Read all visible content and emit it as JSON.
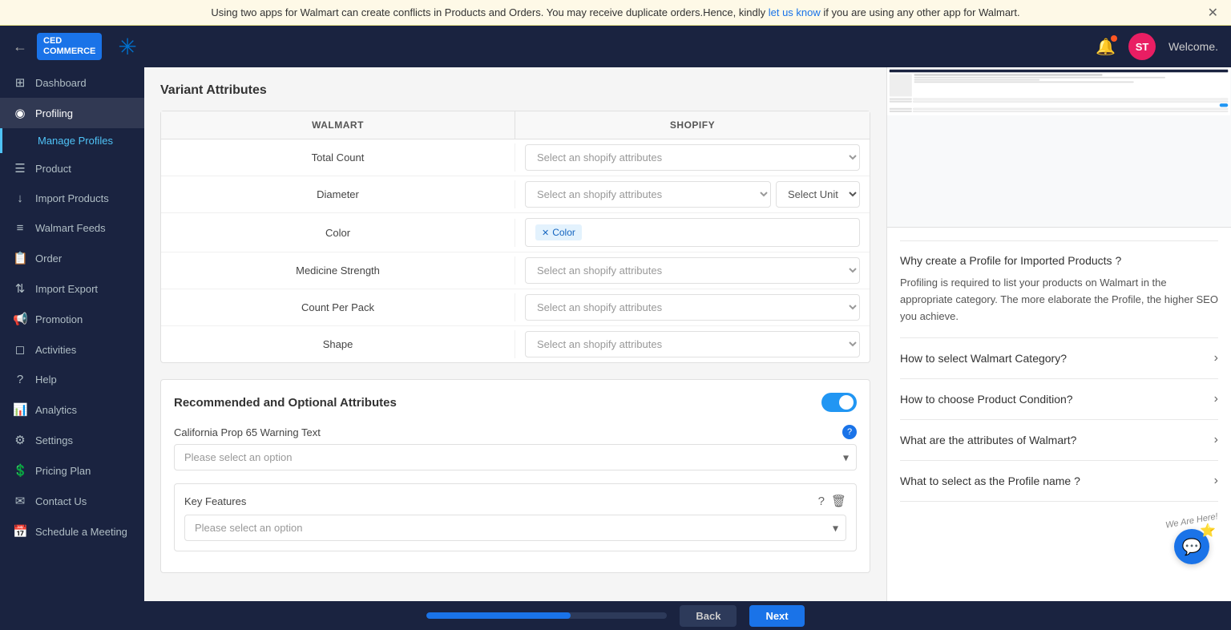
{
  "banner": {
    "text": "Using two apps for Walmart can create conflicts in Products and Orders. You may receive duplicate orders.Hence, kindly ",
    "link_text": "let us know",
    "text_after": " if you are using any other app for Walmart."
  },
  "header": {
    "logo_line1": "CED",
    "logo_line2": "COMMERCE",
    "welcome": "Welcome.",
    "back_label": "←"
  },
  "sidebar": {
    "items": [
      {
        "id": "dashboard",
        "icon": "⊞",
        "label": "Dashboard"
      },
      {
        "id": "profiling",
        "icon": "◉",
        "label": "Profiling",
        "active": true
      },
      {
        "id": "manage-profiles",
        "label": "Manage Profiles",
        "sub": true,
        "active": true
      },
      {
        "id": "product",
        "icon": "☰",
        "label": "Product"
      },
      {
        "id": "import-products",
        "icon": "↓",
        "label": "Import Products"
      },
      {
        "id": "walmart-feeds",
        "icon": "≡",
        "label": "Walmart Feeds"
      },
      {
        "id": "order",
        "icon": "📋",
        "label": "Order"
      },
      {
        "id": "import-export",
        "icon": "⇅",
        "label": "Import Export"
      },
      {
        "id": "promotion",
        "icon": "📢",
        "label": "Promotion"
      },
      {
        "id": "activities",
        "icon": "◻",
        "label": "Activities"
      },
      {
        "id": "help",
        "icon": "?",
        "label": "Help"
      },
      {
        "id": "analytics",
        "icon": "📊",
        "label": "Analytics"
      },
      {
        "id": "settings",
        "icon": "⚙",
        "label": "Settings"
      },
      {
        "id": "pricing-plan",
        "icon": "💲",
        "label": "Pricing Plan"
      },
      {
        "id": "contact-us",
        "icon": "✉",
        "label": "Contact Us"
      },
      {
        "id": "schedule-meeting",
        "icon": "📅",
        "label": "Schedule a Meeting"
      }
    ]
  },
  "variant_attributes": {
    "section_title": "Variant Attributes",
    "col_walmart": "WALMART",
    "col_shopify": "SHOPIFY",
    "rows": [
      {
        "walmart": "Total Count",
        "shopify_placeholder": "Select an shopify attributes"
      },
      {
        "walmart": "Diameter",
        "shopify_placeholder": "Select an shopify attributes",
        "has_unit": true,
        "unit_placeholder": "Select Unit"
      },
      {
        "walmart": "Color",
        "has_tag": true,
        "tag": "Color"
      },
      {
        "walmart": "Medicine Strength",
        "shopify_placeholder": "Select an shopify attributes"
      },
      {
        "walmart": "Count Per Pack",
        "shopify_placeholder": "Select an shopify attributes"
      },
      {
        "walmart": "Shape",
        "shopify_placeholder": "Select an shopify attributes"
      }
    ]
  },
  "recommended": {
    "section_title": "Recommended and Optional Attributes",
    "toggle_on": true,
    "fields": [
      {
        "label": "California Prop 65 Warning Text",
        "placeholder": "Please select an option",
        "has_info": true
      },
      {
        "label": "Key Features",
        "placeholder": "Please select an option",
        "has_info": true,
        "has_delete": true
      }
    ]
  },
  "faq": {
    "title_section": "Why create a Profile for Imported Products ?",
    "description": "Profiling is required to list your products on Walmart in the appropriate category. The more elaborate the Profile, the higher SEO you achieve.",
    "items": [
      {
        "question": "How to select Walmart Category?"
      },
      {
        "question": "How to choose Product Condition?"
      },
      {
        "question": "What are the attributes of Walmart?"
      },
      {
        "question": "What to select as the Profile name ?"
      }
    ]
  },
  "footer": {
    "back_label": "Back",
    "next_label": "Next"
  },
  "chat": {
    "label": "💬",
    "we_are_here": "We Are Here!"
  }
}
